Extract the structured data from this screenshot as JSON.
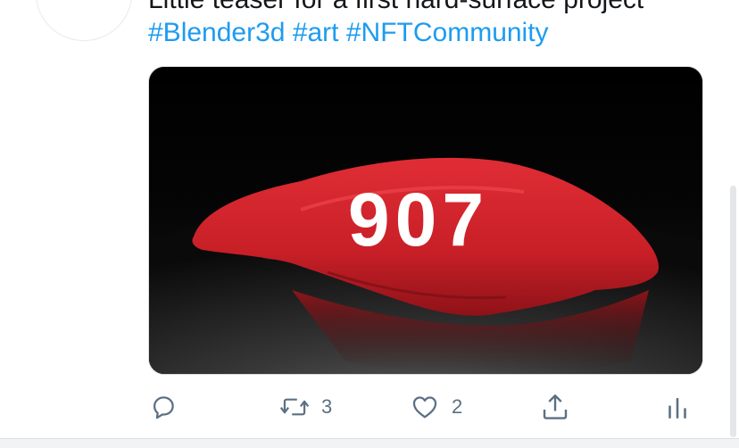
{
  "tweet": {
    "text_line1": "Little teaser for a first hard-surface project",
    "hashtags": [
      "#Blender3d",
      "#art",
      "#NFTCommunity"
    ]
  },
  "media": {
    "overlay_text": "907",
    "cover_color": "#d9222b",
    "background_color": "#050505"
  },
  "actions": {
    "reply": {
      "icon": "reply-icon"
    },
    "retweet": {
      "icon": "retweet-icon",
      "count": "3"
    },
    "like": {
      "icon": "heart-icon",
      "count": "2"
    },
    "share": {
      "icon": "share-icon"
    },
    "analytics": {
      "icon": "analytics-icon"
    }
  },
  "colors": {
    "hashtag": "#1d9bf0",
    "text": "#14171a",
    "action": "#5b7083"
  }
}
